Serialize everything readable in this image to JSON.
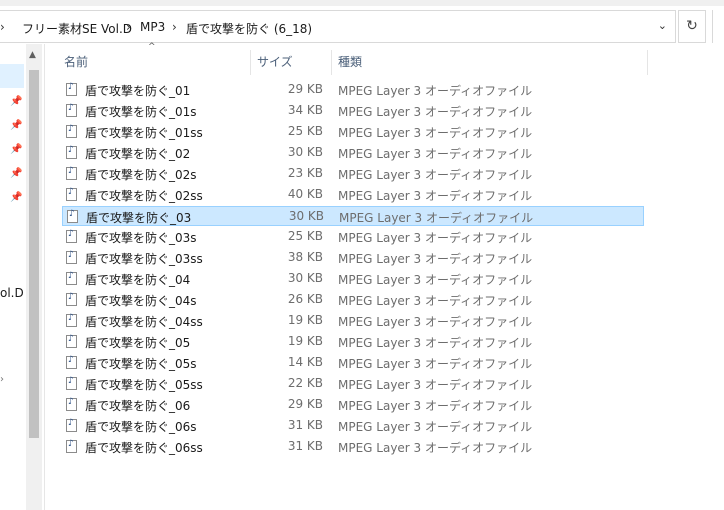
{
  "address": {
    "crumbs": [
      "フリー素材SE Vol.D",
      "MP3",
      "盾で攻撃を防ぐ (6_18)"
    ],
    "separator": "›"
  },
  "nav": {
    "visible_label": "ol.D"
  },
  "columns": {
    "name": "名前",
    "size": "サイズ",
    "type": "種類"
  },
  "files": [
    {
      "name": "盾で攻撃を防ぐ_01",
      "size": "29 KB",
      "type": "MPEG Layer 3 オーディオファイル"
    },
    {
      "name": "盾で攻撃を防ぐ_01s",
      "size": "34 KB",
      "type": "MPEG Layer 3 オーディオファイル"
    },
    {
      "name": "盾で攻撃を防ぐ_01ss",
      "size": "25 KB",
      "type": "MPEG Layer 3 オーディオファイル"
    },
    {
      "name": "盾で攻撃を防ぐ_02",
      "size": "30 KB",
      "type": "MPEG Layer 3 オーディオファイル"
    },
    {
      "name": "盾で攻撃を防ぐ_02s",
      "size": "23 KB",
      "type": "MPEG Layer 3 オーディオファイル"
    },
    {
      "name": "盾で攻撃を防ぐ_02ss",
      "size": "40 KB",
      "type": "MPEG Layer 3 オーディオファイル"
    },
    {
      "name": "盾で攻撃を防ぐ_03",
      "size": "30 KB",
      "type": "MPEG Layer 3 オーディオファイル"
    },
    {
      "name": "盾で攻撃を防ぐ_03s",
      "size": "25 KB",
      "type": "MPEG Layer 3 オーディオファイル"
    },
    {
      "name": "盾で攻撃を防ぐ_03ss",
      "size": "38 KB",
      "type": "MPEG Layer 3 オーディオファイル"
    },
    {
      "name": "盾で攻撃を防ぐ_04",
      "size": "30 KB",
      "type": "MPEG Layer 3 オーディオファイル"
    },
    {
      "name": "盾で攻撃を防ぐ_04s",
      "size": "26 KB",
      "type": "MPEG Layer 3 オーディオファイル"
    },
    {
      "name": "盾で攻撃を防ぐ_04ss",
      "size": "19 KB",
      "type": "MPEG Layer 3 オーディオファイル"
    },
    {
      "name": "盾で攻撃を防ぐ_05",
      "size": "19 KB",
      "type": "MPEG Layer 3 オーディオファイル"
    },
    {
      "name": "盾で攻撃を防ぐ_05s",
      "size": "14 KB",
      "type": "MPEG Layer 3 オーディオファイル"
    },
    {
      "name": "盾で攻撃を防ぐ_05ss",
      "size": "22 KB",
      "type": "MPEG Layer 3 オーディオファイル"
    },
    {
      "name": "盾で攻撃を防ぐ_06",
      "size": "29 KB",
      "type": "MPEG Layer 3 オーディオファイル"
    },
    {
      "name": "盾で攻撃を防ぐ_06s",
      "size": "31 KB",
      "type": "MPEG Layer 3 オーディオファイル"
    },
    {
      "name": "盾で攻撃を防ぐ_06ss",
      "size": "31 KB",
      "type": "MPEG Layer 3 オーディオファイル"
    }
  ],
  "selected_index": 6,
  "icons": {
    "file": "audio-file-icon",
    "pin": "pin-icon",
    "refresh": "refresh-icon",
    "dropdown": "chevron-down-icon",
    "sort": "sort-ascending-icon",
    "scroll_up": "scroll-up-arrow-icon"
  },
  "colors": {
    "selection": "#cce8ff",
    "selection_border": "#99d1ff",
    "header_text": "#4c607a"
  }
}
